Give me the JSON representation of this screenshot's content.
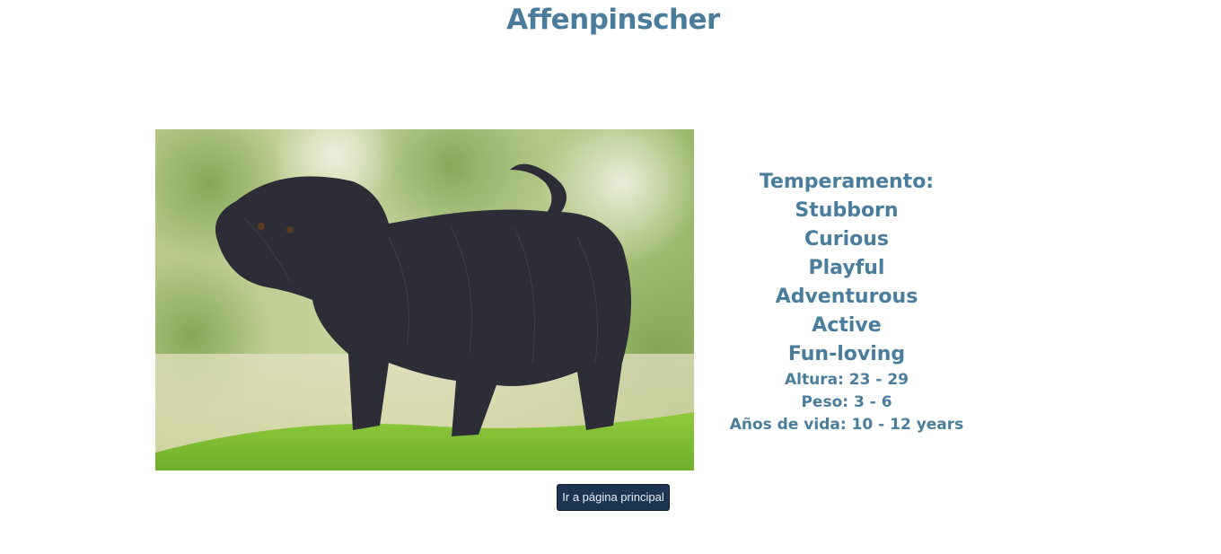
{
  "page": {
    "title": "Affenpinscher"
  },
  "photo": {
    "subject": "black shaggy dog on grass"
  },
  "info": {
    "temperament_label": "Temperamento:",
    "temperaments": [
      "Stubborn",
      "Curious",
      "Playful",
      "Adventurous",
      "Active",
      "Fun-loving"
    ],
    "height": "Altura: 23 - 29",
    "weight": "Peso: 3 - 6",
    "lifespan": "Años de vida: 10 - 12 years"
  },
  "actions": {
    "home_label": "Ir a página principal"
  },
  "colors": {
    "text_accent": "#4a7c9b",
    "button_bg": "#1c3552"
  }
}
